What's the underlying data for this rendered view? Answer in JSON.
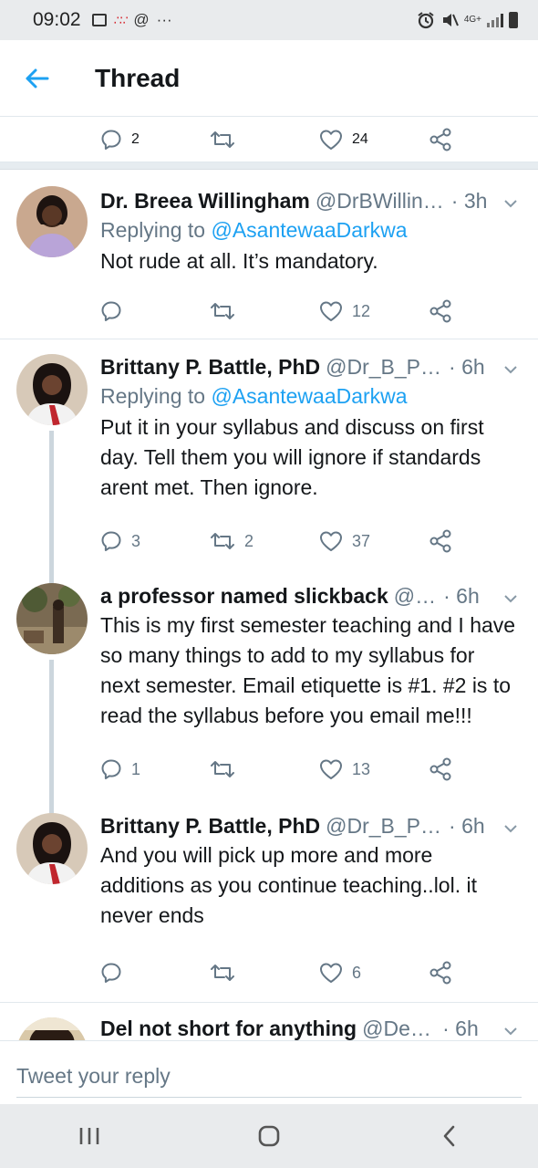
{
  "status_bar": {
    "time": "09:02",
    "left_icons": [
      "image-icon",
      "dots-icon",
      "at-icon",
      "more-icon"
    ],
    "right_icons": [
      "alarm-icon",
      "mute-icon",
      "network-4g-icon",
      "signal-icon",
      "battery-icon"
    ],
    "network_label": "4G+"
  },
  "header": {
    "title": "Thread",
    "accent_color": "#1da1f2"
  },
  "previous_tweet_actions": {
    "replies": "2",
    "retweets": "",
    "likes": "24"
  },
  "tweets": [
    {
      "name": "Dr. Breea Willingham",
      "handle": "@DrBWillin…",
      "time": "· 3h",
      "replying_prefix": "Replying to ",
      "replying_to": "@AsantewaaDarkwa",
      "text": "Not rude at all. It’s mandatory.",
      "replies": "",
      "retweets": "",
      "likes": "12"
    },
    {
      "name": "Brittany P. Battle, PhD",
      "handle": "@Dr_B_P…",
      "time": "· 6h",
      "replying_prefix": "Replying to ",
      "replying_to": "@AsantewaaDarkwa",
      "text": "Put it in your syllabus and discuss on first day. Tell them you will ignore if standards arent met. Then ignore.",
      "replies": "3",
      "retweets": "2",
      "likes": "37"
    },
    {
      "name": "a professor named slickback",
      "handle": "@…",
      "time": "· 6h",
      "text": "This is my first semester teaching and I have so many things to add to my syllabus for next semester. Email etiquette is #1. #2 is to read the syllabus before you email me!!!",
      "replies": "1",
      "retweets": "",
      "likes": "13"
    },
    {
      "name": "Brittany P. Battle, PhD",
      "handle": "@Dr_B_P…",
      "time": "· 6h",
      "text": "And you will pick up more and more additions as you continue teaching..lol. it never ends",
      "replies": "",
      "retweets": "",
      "likes": "6"
    },
    {
      "name": "Del not short for anything",
      "handle": "@Del…",
      "time": "· 6h"
    }
  ],
  "reply_bar": {
    "placeholder": "Tweet your reply"
  },
  "nav_bar": {
    "buttons": [
      "recent-apps-icon",
      "home-icon",
      "back-icon"
    ]
  }
}
